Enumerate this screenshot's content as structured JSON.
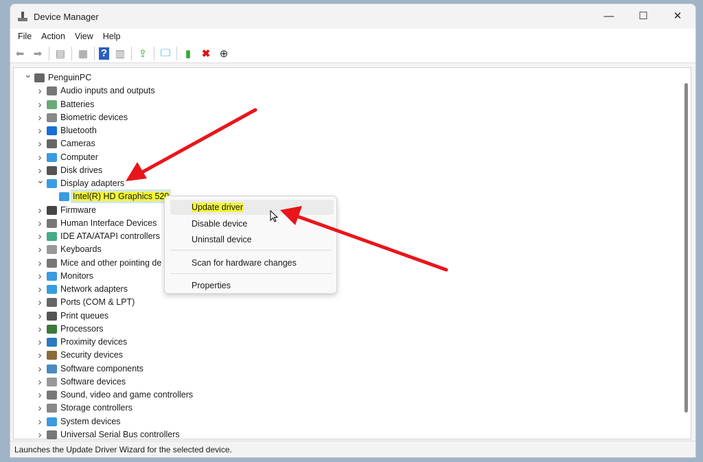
{
  "window": {
    "title": "Device Manager",
    "minimize": "—",
    "maximize": "☐",
    "close": "✕"
  },
  "menu": [
    "File",
    "Action",
    "View",
    "Help"
  ],
  "toolbar": [
    "back-icon",
    "forward-icon",
    "show-hide-console-tree-icon",
    "properties-icon",
    "help-icon",
    "action-pane-icon",
    "update-driver-icon",
    "scan-hardware-icon",
    "enable-device-icon",
    "uninstall-icon",
    "disable-icon"
  ],
  "tree": {
    "root": "PenguinPC",
    "items": [
      {
        "label": "Audio inputs and outputs",
        "color": "#777"
      },
      {
        "label": "Batteries",
        "color": "#6a7"
      },
      {
        "label": "Biometric devices",
        "color": "#888"
      },
      {
        "label": "Bluetooth",
        "color": "#1a6fd8"
      },
      {
        "label": "Cameras",
        "color": "#666"
      },
      {
        "label": "Computer",
        "color": "#3a9be0"
      },
      {
        "label": "Disk drives",
        "color": "#555"
      },
      {
        "label": "Display adapters",
        "color": "#3a9be0",
        "expanded": true,
        "children": [
          "Intel(R) HD Graphics 520"
        ]
      },
      {
        "label": "Firmware",
        "color": "#444"
      },
      {
        "label": "Human Interface Devices",
        "color": "#777"
      },
      {
        "label": "IDE ATA/ATAPI controllers",
        "color": "#4a8"
      },
      {
        "label": "Keyboards",
        "color": "#999"
      },
      {
        "label": "Mice and other pointing de",
        "color": "#777"
      },
      {
        "label": "Monitors",
        "color": "#3a9be0"
      },
      {
        "label": "Network adapters",
        "color": "#3a9be0"
      },
      {
        "label": "Ports (COM & LPT)",
        "color": "#666"
      },
      {
        "label": "Print queues",
        "color": "#555"
      },
      {
        "label": "Processors",
        "color": "#3a7a3a"
      },
      {
        "label": "Proximity devices",
        "color": "#2a7ac0"
      },
      {
        "label": "Security devices",
        "color": "#8a6a3a"
      },
      {
        "label": "Software components",
        "color": "#4a8ac0"
      },
      {
        "label": "Software devices",
        "color": "#999"
      },
      {
        "label": "Sound, video and game controllers",
        "color": "#777"
      },
      {
        "label": "Storage controllers",
        "color": "#888"
      },
      {
        "label": "System devices",
        "color": "#3a9be0"
      },
      {
        "label": "Universal Serial Bus controllers",
        "color": "#777"
      }
    ]
  },
  "context_menu": {
    "items": [
      "Update driver",
      "Disable device",
      "Uninstall device",
      "Scan for hardware changes",
      "Properties"
    ]
  },
  "status": "Launches the Update Driver Wizard for the selected device.",
  "annotation_color": "#e8161b"
}
